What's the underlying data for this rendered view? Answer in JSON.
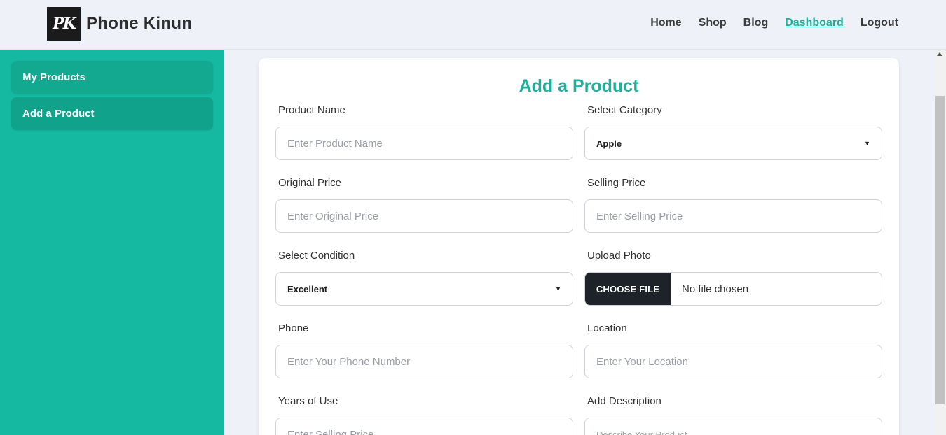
{
  "header": {
    "logo_text": "PK",
    "brand": "Phone Kinun",
    "nav": [
      {
        "label": "Home"
      },
      {
        "label": "Shop"
      },
      {
        "label": "Blog"
      },
      {
        "label": "Dashboard",
        "active": true
      },
      {
        "label": "Logout"
      }
    ]
  },
  "sidebar": {
    "items": [
      {
        "label": "My Products"
      },
      {
        "label": "Add a Product",
        "active": true
      }
    ]
  },
  "form": {
    "title": "Add a Product",
    "product_name": {
      "label": "Product Name",
      "placeholder": "Enter Product Name"
    },
    "category": {
      "label": "Select Category",
      "value": "Apple"
    },
    "original_price": {
      "label": "Original Price",
      "placeholder": "Enter Original Price"
    },
    "selling_price": {
      "label": "Selling Price",
      "placeholder": "Enter Selling Price"
    },
    "condition": {
      "label": "Select Condition",
      "value": "Excellent"
    },
    "photo": {
      "label": "Upload Photo",
      "button": "CHOOSE FILE",
      "status": "No file chosen"
    },
    "phone": {
      "label": "Phone",
      "placeholder": "Enter Your Phone Number"
    },
    "location": {
      "label": "Location",
      "placeholder": "Enter Your Location"
    },
    "years_of_use": {
      "label": "Years of Use",
      "placeholder": "Enter Selling Price"
    },
    "description": {
      "label": "Add Description",
      "placeholder": "Describe Your Product"
    }
  },
  "colors": {
    "accent": "#1fb09a",
    "sidebar": "#15b8a0",
    "background": "#eef1f8"
  }
}
